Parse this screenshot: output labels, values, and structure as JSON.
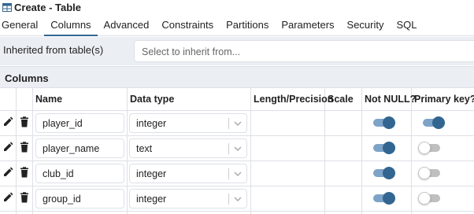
{
  "dialog": {
    "title": "Create - Table",
    "icon": "table-icon"
  },
  "tabs": [
    {
      "label": "General",
      "active": false
    },
    {
      "label": "Columns",
      "active": true
    },
    {
      "label": "Advanced",
      "active": false
    },
    {
      "label": "Constraints",
      "active": false
    },
    {
      "label": "Partitions",
      "active": false
    },
    {
      "label": "Parameters",
      "active": false
    },
    {
      "label": "Security",
      "active": false
    },
    {
      "label": "SQL",
      "active": false
    }
  ],
  "inherit": {
    "label": "Inherited from table(s)",
    "placeholder": "Select to inherit from..."
  },
  "columns_section": {
    "title": "Columns"
  },
  "table": {
    "headers": [
      "Name",
      "Data type",
      "Length/Precision",
      "Scale",
      "Not NULL?",
      "Primary key?"
    ],
    "rows": [
      {
        "name": "player_id",
        "data_type": "integer",
        "length": "",
        "scale": "",
        "not_null": true,
        "primary_key": true
      },
      {
        "name": "player_name",
        "data_type": "text",
        "length": "",
        "scale": "",
        "not_null": true,
        "primary_key": false
      },
      {
        "name": "club_id",
        "data_type": "integer",
        "length": "",
        "scale": "",
        "not_null": true,
        "primary_key": false
      },
      {
        "name": "group_id",
        "data_type": "integer",
        "length": "",
        "scale": "",
        "not_null": true,
        "primary_key": false
      }
    ]
  },
  "colors": {
    "accent": "#326690",
    "toggle_on_track": "#7da3c8",
    "panel_bg": "#ebeef3",
    "border": "#dde0e6"
  }
}
